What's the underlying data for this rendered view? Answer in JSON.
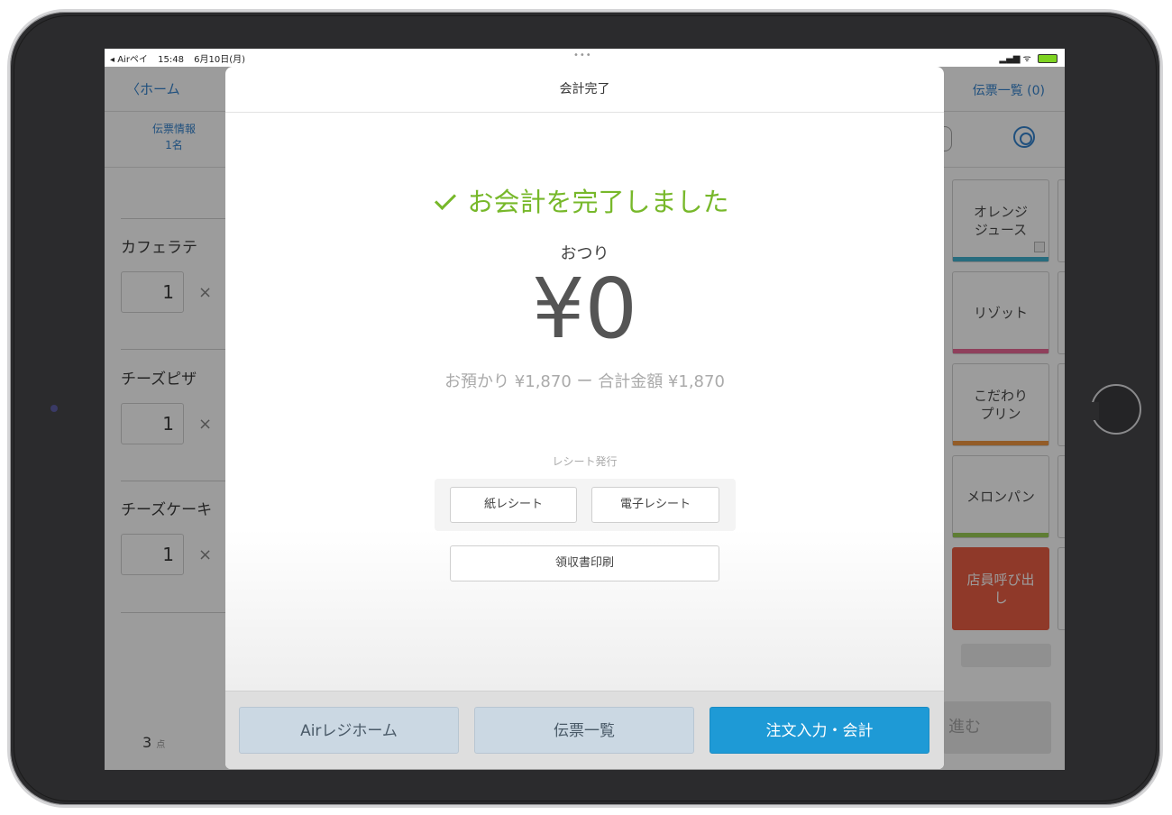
{
  "status_bar": {
    "back_app": "◂ Airペイ",
    "time": "15:48",
    "date": "6月10日(月)",
    "dots": "•••",
    "signal": "▂▄▆",
    "wifi": "ᯤ"
  },
  "background": {
    "back_label": "ホーム",
    "slip_list": "伝票一覧 (0)",
    "info_label": "伝票情報",
    "guests": "1名",
    "items": [
      {
        "name": "カフェラテ",
        "qty": "1",
        "times": "×"
      },
      {
        "name": "チーズピザ",
        "qty": "1",
        "times": "×"
      },
      {
        "name": "チーズケーキ",
        "qty": "1",
        "times": "×"
      }
    ],
    "item_count": "3",
    "item_count_unit": "点",
    "tiles": [
      {
        "label": "オレンジ\nジュース",
        "color": "#2aa6c8"
      },
      {
        "label": "リゾット",
        "color": "#e8558a"
      },
      {
        "label": "こだわり\nプリン",
        "color": "#ee8a2a"
      },
      {
        "label": "メロンパン",
        "color": "#8dc63f"
      },
      {
        "label": "店員呼び出\nし",
        "color": "#e8482c"
      }
    ],
    "proceed_label": "進む"
  },
  "modal": {
    "title": "会計完了",
    "done_message": "お会計を完了しました",
    "change_label": "おつり",
    "change_amount": "¥0",
    "calc_line": "お預かり ¥1,870 ー 合計金額 ¥1,870",
    "receipt_label": "レシート発行",
    "paper_receipt": "紙レシート",
    "e_receipt": "電子レシート",
    "invoice_print": "領収書印刷",
    "footer": {
      "home": "Airレジホーム",
      "slip_list": "伝票一覧",
      "order": "注文入力・会計"
    }
  },
  "colors": {
    "accent": "#1e9ad6",
    "success": "#77b82a",
    "link": "#1a73c7"
  }
}
